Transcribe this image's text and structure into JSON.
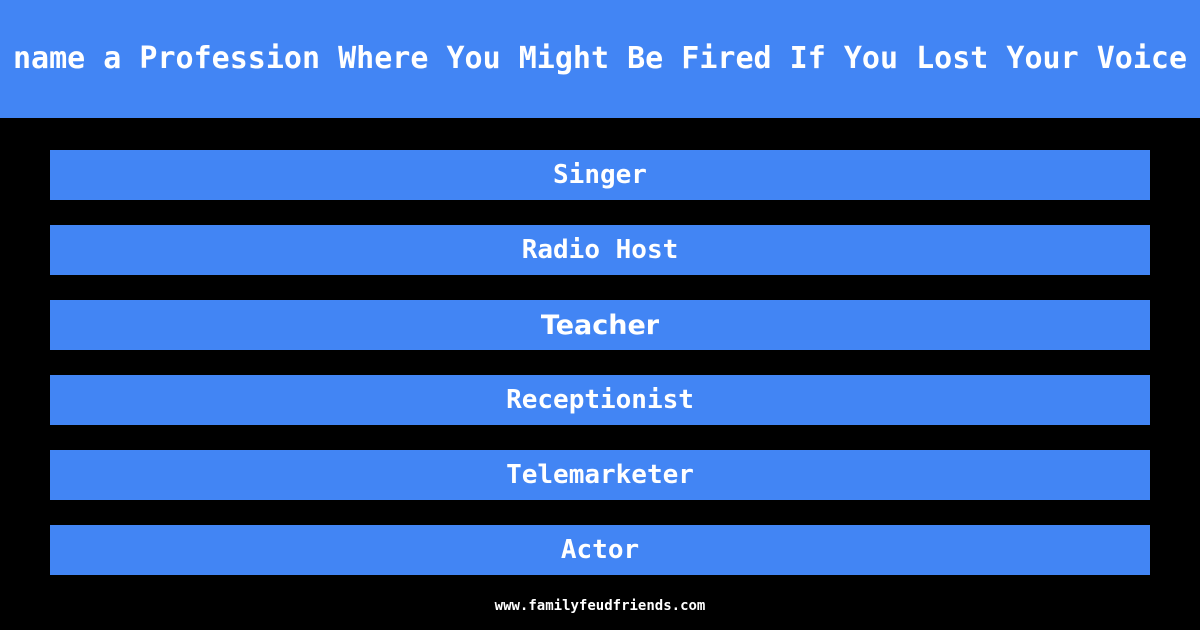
{
  "header": {
    "question": "name a Profession Where You Might Be Fired If You Lost Your Voice",
    "background_color": "#4285f4",
    "text_color": "#ffffff"
  },
  "answers": {
    "background_color": "#4285f4",
    "text_color": "#ffffff",
    "items": [
      {
        "label": "Singer"
      },
      {
        "label": "Radio Host"
      },
      {
        "label": "Teacher"
      },
      {
        "label": "Receptionist"
      },
      {
        "label": "Telemarketer"
      },
      {
        "label": "Actor"
      }
    ]
  },
  "footer": {
    "url": "www.familyfeudfriends.com",
    "text_color": "#ffffff"
  },
  "page": {
    "background_color": "#000000"
  }
}
